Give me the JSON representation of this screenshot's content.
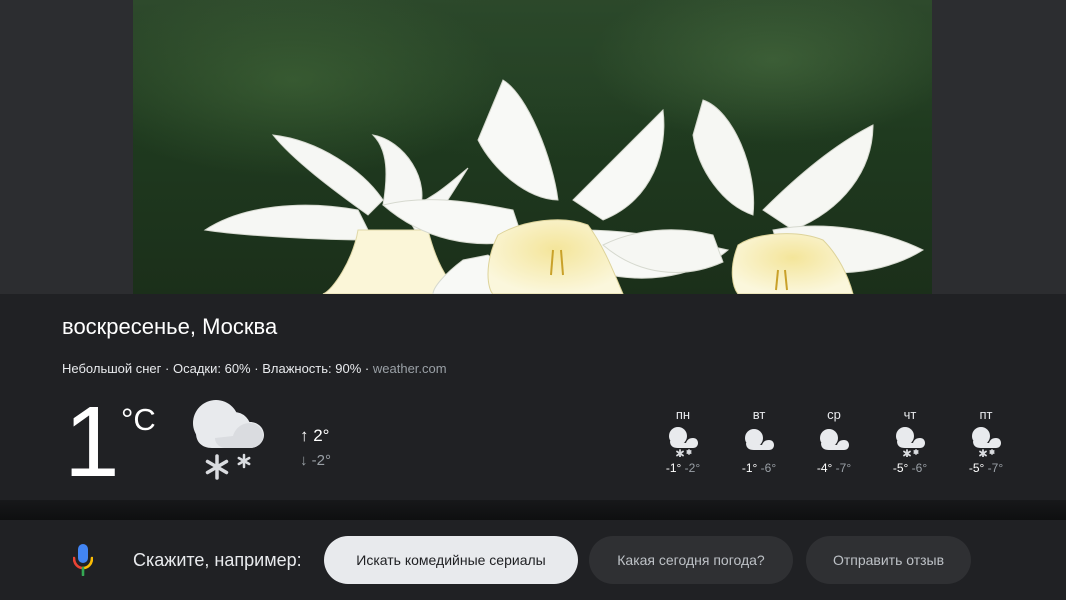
{
  "weather": {
    "title": "воскресенье, Москва",
    "condition": "Небольшой снег",
    "precipitation": "Осадки: 60%",
    "humidity": "Влажность: 90%",
    "source": "weather.com",
    "separator": "·",
    "temperature": "1",
    "unit": "°C",
    "high": "↑ 2°",
    "low": "↓ -2°",
    "icon": "light-snow-icon"
  },
  "forecast": [
    {
      "day": "пн",
      "high": "-1°",
      "low": "-2°",
      "icon": "snow-icon"
    },
    {
      "day": "вт",
      "high": "-1°",
      "low": "-6°",
      "icon": "cloud-icon"
    },
    {
      "day": "ср",
      "high": "-4°",
      "low": "-7°",
      "icon": "cloud-icon"
    },
    {
      "day": "чт",
      "high": "-5°",
      "low": "-6°",
      "icon": "snow-icon"
    },
    {
      "day": "пт",
      "high": "-5°",
      "low": "-7°",
      "icon": "snow-icon"
    }
  ],
  "assistant": {
    "mic_icon": "google-mic-icon",
    "hint": "Скажите, например:",
    "suggestions": [
      "Искать комедийные сериалы",
      "Какая сегодня погода?",
      "Отправить отзыв"
    ]
  },
  "colors": {
    "card_bg": "#202124",
    "outer_bg": "#2c2d30",
    "chip_active_bg": "#e8eaed",
    "chip_bg": "#2f3033"
  }
}
